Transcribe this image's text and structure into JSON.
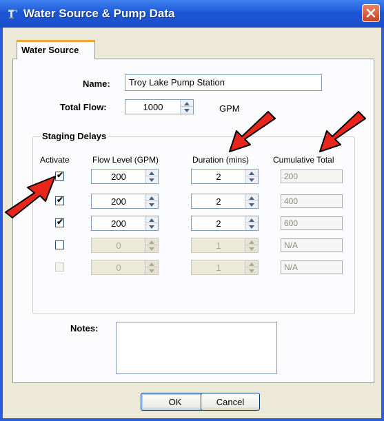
{
  "window": {
    "title": "Water Source & Pump Data",
    "icon": "pump-app-icon",
    "close_icon": "close-icon"
  },
  "tabs": [
    {
      "label": "Water Source",
      "active": true
    }
  ],
  "form": {
    "name_label": "Name:",
    "name_value": "Troy Lake Pump Station",
    "total_flow_label": "Total Flow:",
    "total_flow_value": "1000",
    "total_flow_unit": "GPM"
  },
  "staging": {
    "group_title": "Staging Delays",
    "headers": {
      "activate": "Activate",
      "flow_level": "Flow Level (GPM)",
      "duration": "Duration (mins)",
      "cumulative": "Cumulative Total"
    },
    "rows": [
      {
        "active": true,
        "enabled": true,
        "flow": "200",
        "duration": "2",
        "cumulative": "200"
      },
      {
        "active": true,
        "enabled": true,
        "flow": "200",
        "duration": "2",
        "cumulative": "400"
      },
      {
        "active": true,
        "enabled": true,
        "flow": "200",
        "duration": "2",
        "cumulative": "600"
      },
      {
        "active": false,
        "enabled": true,
        "flow": "0",
        "duration": "1",
        "cumulative": "N/A"
      },
      {
        "active": false,
        "enabled": false,
        "flow": "0",
        "duration": "1",
        "cumulative": "N/A"
      }
    ]
  },
  "notes": {
    "label": "Notes:",
    "value": ""
  },
  "buttons": {
    "ok": "OK",
    "cancel": "Cancel"
  },
  "colors": {
    "title_bar": "#1d57d6",
    "dialog_bg": "#ece9d8",
    "tab_accent": "#f2a33a",
    "annotation_arrow": "#e8261c"
  }
}
